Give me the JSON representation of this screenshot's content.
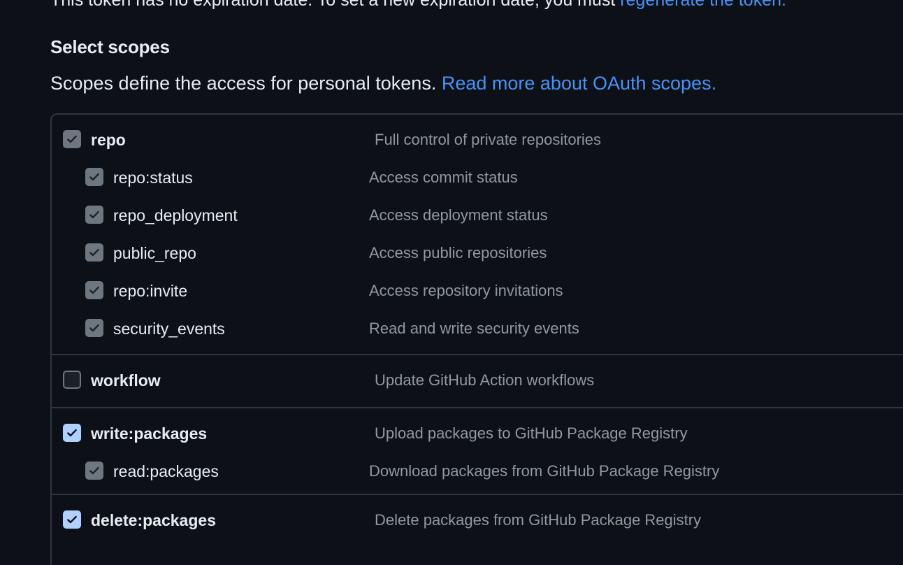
{
  "top_note": {
    "text": "This token has no expiration date. To set a new expiration date, you must ",
    "link": "regenerate the token."
  },
  "section": {
    "title": "Select scopes",
    "description": "Scopes define the access for personal tokens.",
    "link": "Read more about OAuth scopes."
  },
  "scopes": [
    {
      "name": "repo",
      "description": "Full control of private repositories",
      "state": "disabled-checked",
      "children": [
        {
          "name": "repo:status",
          "description": "Access commit status",
          "state": "disabled-checked"
        },
        {
          "name": "repo_deployment",
          "description": "Access deployment status",
          "state": "disabled-checked"
        },
        {
          "name": "public_repo",
          "description": "Access public repositories",
          "state": "disabled-checked"
        },
        {
          "name": "repo:invite",
          "description": "Access repository invitations",
          "state": "disabled-checked"
        },
        {
          "name": "security_events",
          "description": "Read and write security events",
          "state": "disabled-checked"
        }
      ]
    },
    {
      "name": "workflow",
      "description": "Update GitHub Action workflows",
      "state": "unchecked",
      "children": []
    },
    {
      "name": "write:packages",
      "description": "Upload packages to GitHub Package Registry",
      "state": "checked",
      "children": [
        {
          "name": "read:packages",
          "description": "Download packages from GitHub Package Registry",
          "state": "disabled-checked"
        }
      ]
    },
    {
      "name": "delete:packages",
      "description": "Delete packages from GitHub Package Registry",
      "state": "checked",
      "children": []
    }
  ],
  "colors": {
    "background": "#0d1117",
    "border": "#30363d",
    "link": "#4493f8",
    "text": "#e6edf3",
    "muted": "#9198a1",
    "checkbox_checked": "#afd1ff",
    "checkbox_disabled": "#6e7681"
  },
  "icons": {
    "checkmark": "check-icon"
  }
}
